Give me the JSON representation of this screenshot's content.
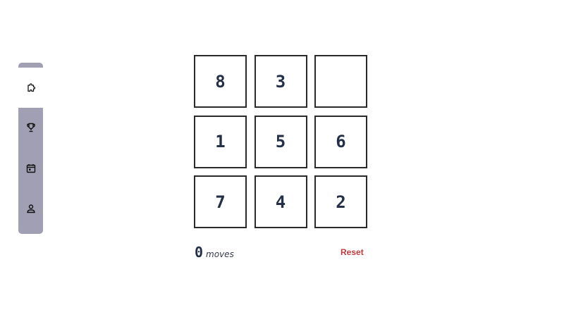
{
  "sidebar": {
    "items": [
      {
        "icon": "puzzle-icon",
        "active": true
      },
      {
        "icon": "trophy-icon",
        "active": false
      },
      {
        "icon": "calendar-icon",
        "active": false
      },
      {
        "icon": "user-icon",
        "active": false
      }
    ]
  },
  "board": {
    "tiles": [
      {
        "value": "8"
      },
      {
        "value": "3"
      },
      {
        "value": ""
      },
      {
        "value": "1"
      },
      {
        "value": "5"
      },
      {
        "value": "6"
      },
      {
        "value": "7"
      },
      {
        "value": "4"
      },
      {
        "value": "2"
      }
    ]
  },
  "footer": {
    "moves_count": "0",
    "moves_label": "moves",
    "reset_label": "Reset"
  },
  "colors": {
    "sidebar_bg": "#a09fb4",
    "tile_text": "#233047",
    "reset_text": "#c0393f"
  }
}
